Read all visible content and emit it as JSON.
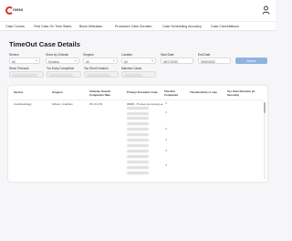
{
  "header": {
    "logo_text": "OMNI",
    "logo_icon": "omni-logo",
    "user_icon": "user-icon"
  },
  "tabs": [
    "Case Counts",
    "First Case On Time Starts",
    "Block Utilization",
    "Procedure Case Duration",
    "Case Scheduling Accuracy",
    "Case Cancellations"
  ],
  "page": {
    "title": "TimeOut Case Details"
  },
  "filters": {
    "service": {
      "label": "Service",
      "value": "All"
    },
    "show_by": {
      "label": "Show by Clinician",
      "value": "Surgeon"
    },
    "surgeon": {
      "label": "Surgeon",
      "value": "All"
    },
    "location": {
      "label": "Location",
      "value": "All"
    },
    "start_date": {
      "label": "Start Date",
      "value": "08/17/2020"
    },
    "end_date": {
      "label": "End Date",
      "value": "09/30/2022"
    },
    "search_label": "Search",
    "show_timeouts": {
      "label": "Show Timeouts",
      "value": ""
    },
    "too_early": {
      "label": "Too Early Completion",
      "value": ""
    },
    "too_short": {
      "label": "Too Short Duration",
      "value": ""
    },
    "matched_cases": {
      "label": "Matched Cases",
      "value": ""
    }
  },
  "table": {
    "columns": [
      "Service",
      "Surgeon",
      "Clinician Overall Completion Rate",
      "Primary Procedure Code",
      "TimeOut Completed",
      "TimeOut Early or Late",
      "Too Short Duration (in Seconds)"
    ],
    "first_row": {
      "service": "Anesthesiology",
      "surgeon": "Gibson, Jonathan",
      "rate": "0% (0 of 6)",
      "code_prefix": "00820 - PI anes ure rectoug ▲"
    },
    "status_icon": "x-mark-icon",
    "status_color": "#e0463c"
  }
}
